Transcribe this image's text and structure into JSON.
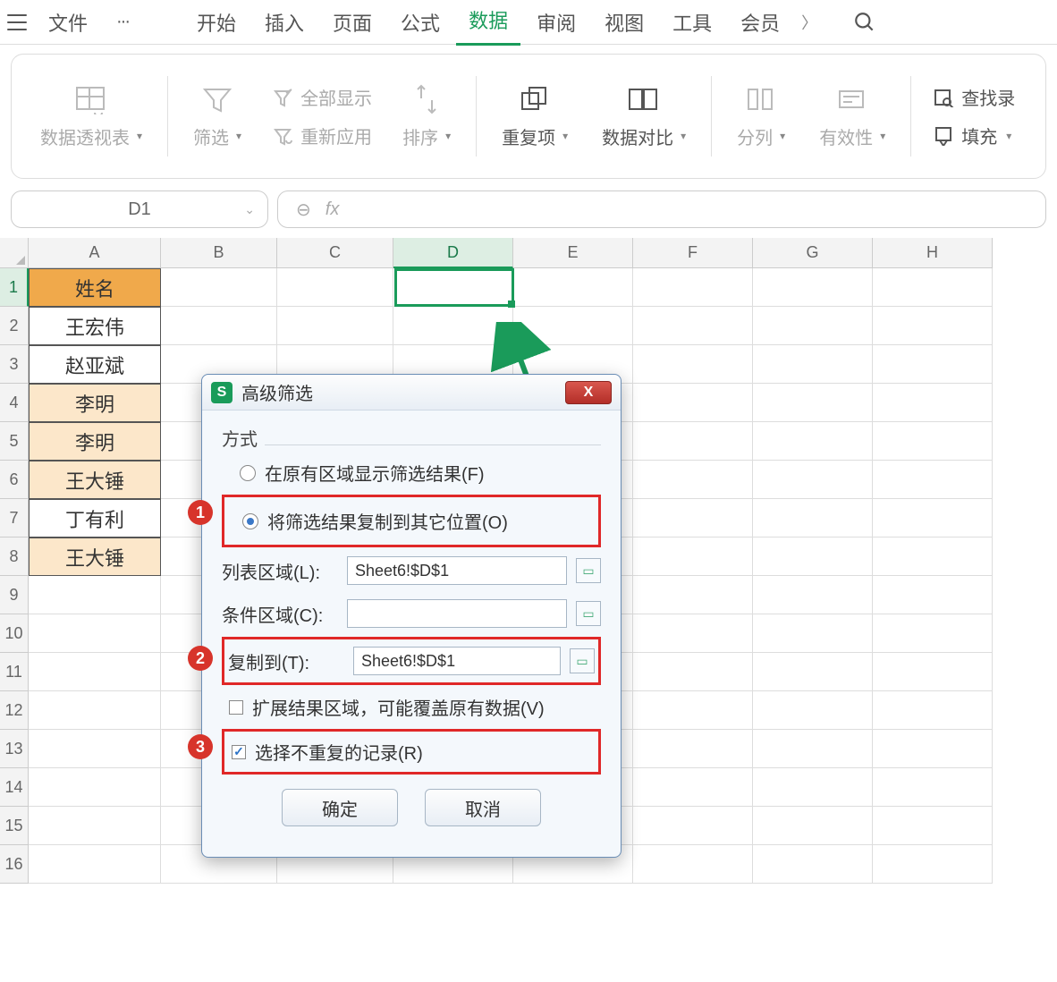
{
  "menubar": {
    "file": "文件",
    "more": "···",
    "tabs": [
      "开始",
      "插入",
      "页面",
      "公式",
      "数据",
      "审阅",
      "视图",
      "工具",
      "会员"
    ],
    "active_index": 4
  },
  "ribbon": {
    "pivot": "数据透视表",
    "filter": "筛选",
    "show_all": "全部显示",
    "reapply": "重新应用",
    "sort": "排序",
    "duplicates": "重复项",
    "compare": "数据对比",
    "split": "分列",
    "validity": "有效性",
    "find_record": "查找录",
    "fill": "填充"
  },
  "formula": {
    "namebox": "D1",
    "fx": "fx"
  },
  "columns": [
    "A",
    "B",
    "C",
    "D",
    "E",
    "F",
    "G",
    "H"
  ],
  "rows": [
    "1",
    "2",
    "3",
    "4",
    "5",
    "6",
    "7",
    "8",
    "9",
    "10",
    "11",
    "12",
    "13",
    "14",
    "15",
    "16"
  ],
  "cells": {
    "A1": "姓名",
    "A2": "王宏伟",
    "A3": "赵亚斌",
    "A4": "李明",
    "A5": "李明",
    "A6": "王大锤",
    "A7": "丁有利",
    "A8": "王大锤"
  },
  "highlight_rows": [
    4,
    5,
    6,
    8
  ],
  "active_cell": "D1",
  "dialog": {
    "title": "高级筛选",
    "section_mode": "方式",
    "radio_inplace": "在原有区域显示筛选结果(F)",
    "radio_copy": "将筛选结果复制到其它位置(O)",
    "label_list": "列表区域(L):",
    "val_list": "Sheet6!$D$1",
    "label_cond": "条件区域(C):",
    "val_cond": "",
    "label_copy": "复制到(T):",
    "val_copy": "Sheet6!$D$1",
    "chk_extend": "扩展结果区域，可能覆盖原有数据(V)",
    "chk_unique": "选择不重复的记录(R)",
    "btn_ok": "确定",
    "btn_cancel": "取消",
    "icon_letter": "S",
    "close_x": "X"
  },
  "badges": {
    "b1": "1",
    "b2": "2",
    "b3": "3"
  }
}
